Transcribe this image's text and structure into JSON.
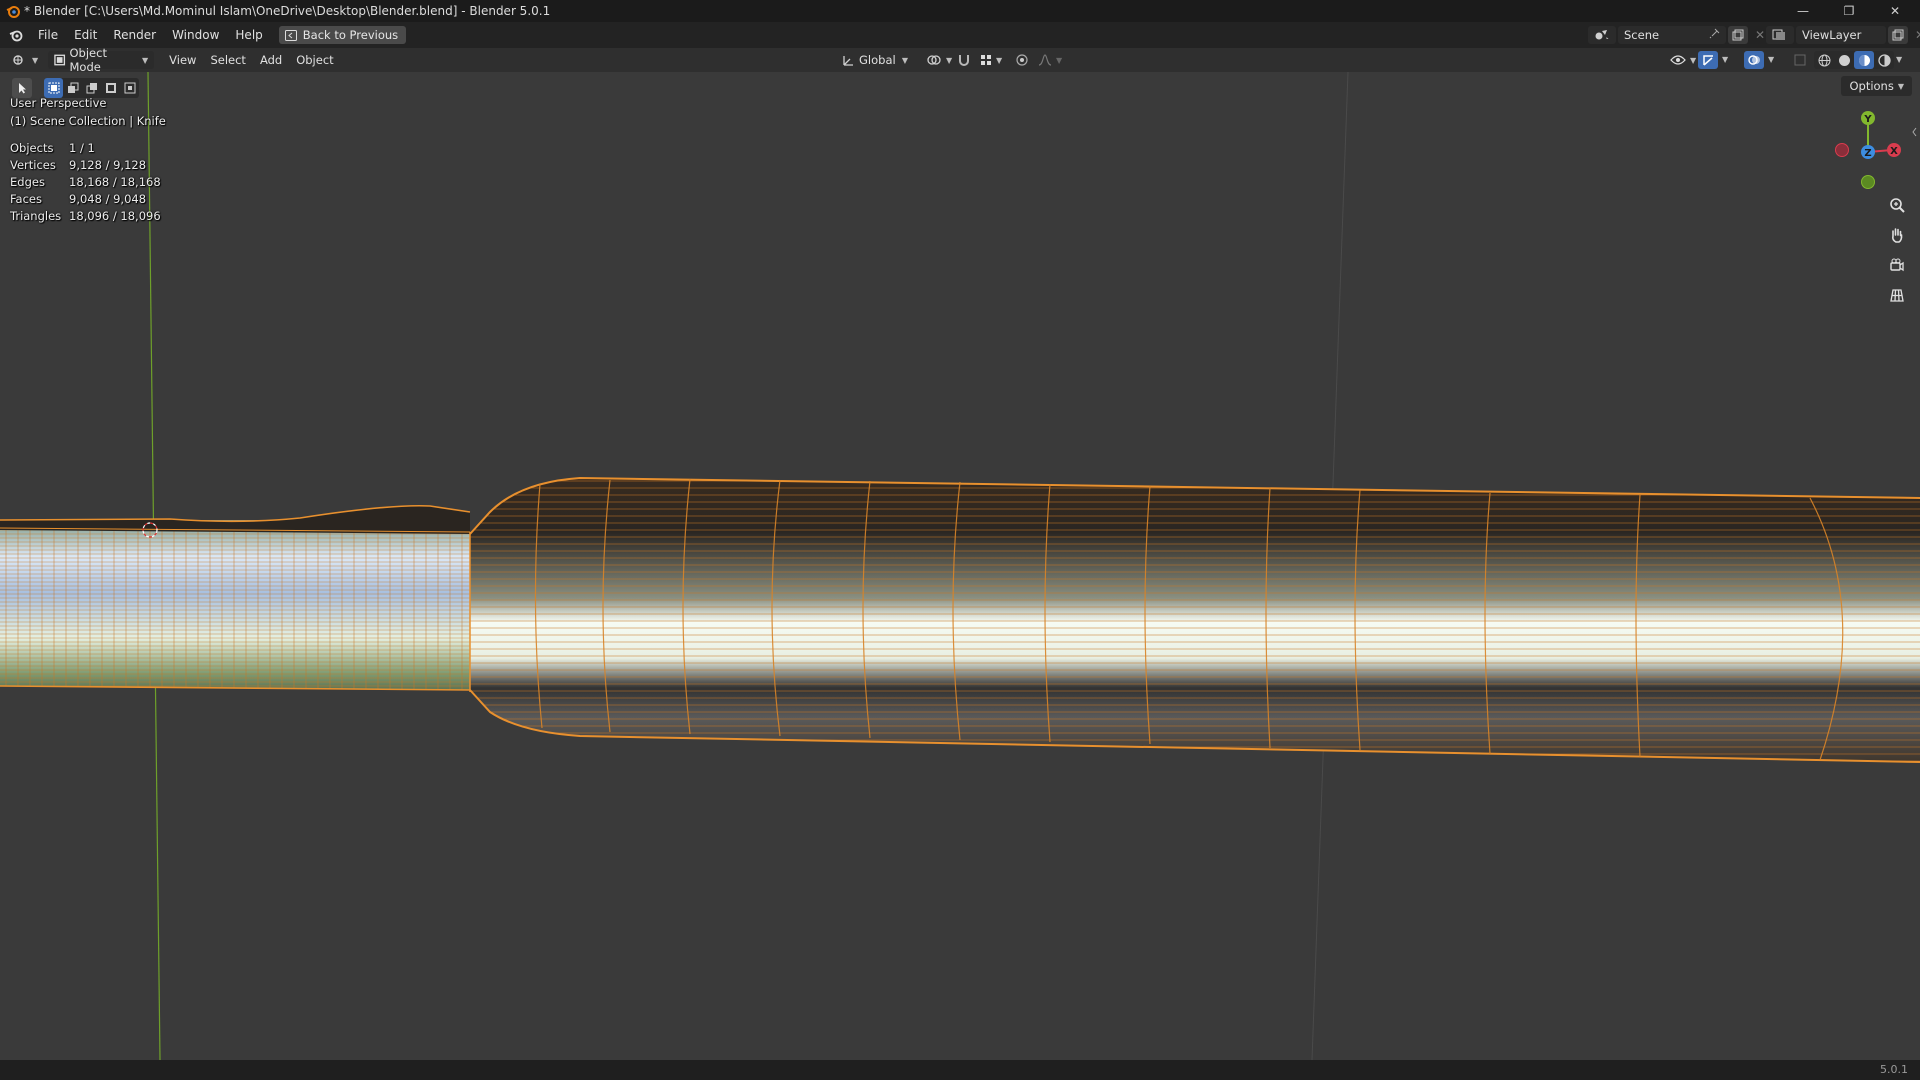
{
  "window": {
    "title": "* Blender [C:\\Users\\Md.Mominul Islam\\OneDrive\\Desktop\\Blender.blend] - Blender 5.0.1",
    "controls": {
      "minimize": "—",
      "maximize": "❐",
      "close": "✕"
    }
  },
  "menubar": {
    "items": [
      "File",
      "Edit",
      "Render",
      "Window",
      "Help"
    ],
    "back_button": "Back to Previous",
    "scene_name": "Scene",
    "view_layer": "ViewLayer"
  },
  "viewport_header": {
    "mode": "Object Mode",
    "menus": [
      "View",
      "Select",
      "Add",
      "Object"
    ],
    "transform_orientation": "Global"
  },
  "viewport": {
    "options_label": "Options",
    "overlay": {
      "perspective": "User Perspective",
      "collection": "(1) Scene Collection | Knife"
    },
    "stats": [
      {
        "label": "Objects",
        "value": "1 / 1"
      },
      {
        "label": "Vertices",
        "value": "9,128 / 9,128"
      },
      {
        "label": "Edges",
        "value": "18,168 / 18,168"
      },
      {
        "label": "Faces",
        "value": "9,048 / 9,048"
      },
      {
        "label": "Triangles",
        "value": "18,096 / 18,096"
      }
    ],
    "gizmo_axes": {
      "y": "Y",
      "z": "Z",
      "x": "X"
    },
    "colors": {
      "background": "#3a3a3a",
      "wire_orange": "#e8902e",
      "axis_x": "#d93c4e",
      "axis_y": "#82b82e",
      "axis_z": "#3d8de0",
      "active_blue": "#3d6cb3"
    },
    "icons": [
      "zoom-icon",
      "hand-icon",
      "camera-icon",
      "grid-icon"
    ]
  },
  "statusbar": {
    "version": "5.0.1"
  }
}
